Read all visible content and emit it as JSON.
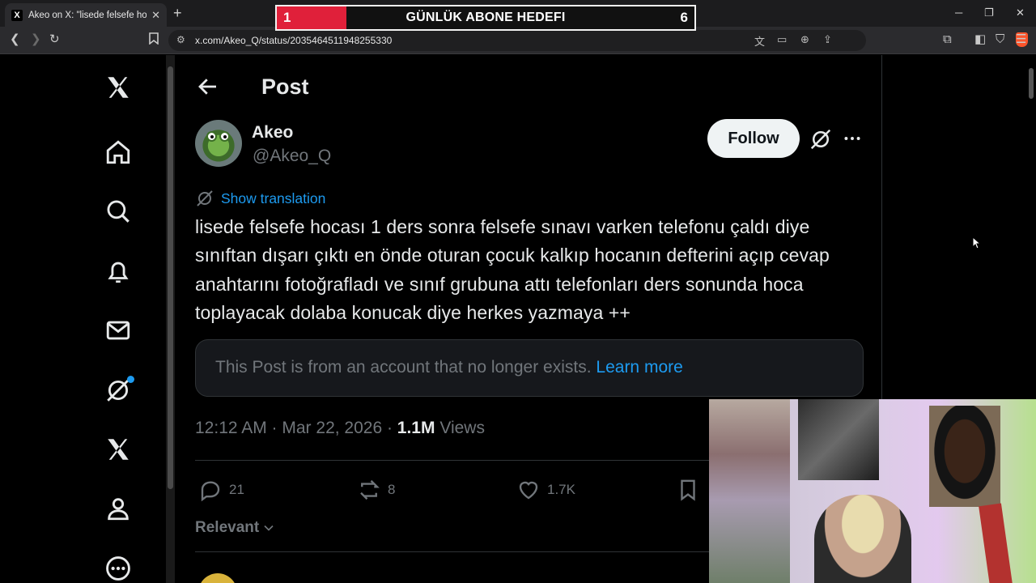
{
  "browser": {
    "tab_title": "Akeo on X: \"lisede felsefe hocası",
    "tab_favicon": "X",
    "url": "x.com/Akeo_Q/status/2035464511948255330"
  },
  "goal_overlay": {
    "current": "1",
    "label": "GÜNLÜK ABONE HEDEFI",
    "target": "6",
    "progress_fraction": 0.167
  },
  "sidebar": {
    "items": [
      {
        "icon": "x-logo-icon"
      },
      {
        "icon": "home-icon"
      },
      {
        "icon": "search-icon"
      },
      {
        "icon": "bell-icon"
      },
      {
        "icon": "mail-icon"
      },
      {
        "icon": "grok-icon"
      },
      {
        "icon": "x-premium-icon"
      },
      {
        "icon": "profile-icon"
      },
      {
        "icon": "more-circle-icon"
      }
    ]
  },
  "header": {
    "title": "Post"
  },
  "post": {
    "author_name": "Akeo",
    "author_handle": "@Akeo_Q",
    "follow_label": "Follow",
    "translate_label": "Show translation",
    "text": "lisede felsefe hocası 1 ders sonra felsefe sınavı varken telefonu çaldı diye sınıftan dışarı çıktı en önde oturan çocuk kalkıp hocanın defterini açıp cevap anahtarını fotoğrafladı ve sınıf grubuna attı telefonları ders sonunda hoca toplayacak dolaba konucak diye herkes yazmaya ++",
    "notice_text": "This Post is from an account that no longer exists.",
    "notice_link": "Learn more",
    "time": "12:12 AM · Mar 22, 2026 · ",
    "views_count": "1.1M",
    "views_label": " Views",
    "replies": "21",
    "reposts": "8",
    "likes": "1.7K",
    "sort_label": "Relevant"
  },
  "colors": {
    "accent": "#1d9bf0",
    "background": "#000000",
    "muted": "#71767b",
    "goal_fill": "#e0203a"
  }
}
